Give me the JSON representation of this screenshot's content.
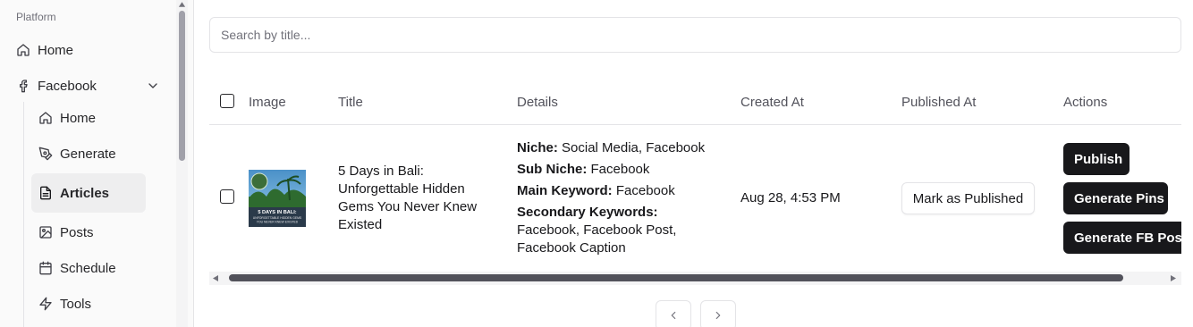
{
  "sidebar": {
    "section_label": "Platform",
    "home": "Home",
    "facebook": "Facebook",
    "sub_items": [
      "Home",
      "Generate",
      "Articles",
      "Posts",
      "Schedule",
      "Tools"
    ],
    "active": "Articles"
  },
  "search": {
    "placeholder": "Search by title...",
    "value": ""
  },
  "table": {
    "columns": [
      "Image",
      "Title",
      "Details",
      "Created At",
      "Published At",
      "Actions"
    ],
    "rows": [
      {
        "image_caption": "5 DAYS IN BALI: UNFORGETTABLE HIDDEN GEMS YOU NEVER KNEW EXISTED",
        "title": "5 Days in Bali: Unforgettable Hidden Gems You Never Knew Existed",
        "details": {
          "niche_label": "Niche:",
          "niche": "Social Media, Facebook",
          "sub_niche_label": "Sub Niche:",
          "sub_niche": "Facebook",
          "main_keyword_label": "Main Keyword:",
          "main_keyword": "Facebook",
          "secondary_keywords_label": "Secondary Keywords:",
          "secondary_keywords": "Facebook, Facebook Post, Facebook Caption"
        },
        "created_at": "Aug 28, 4:53 PM",
        "published_action": "Mark as Published",
        "actions": [
          "Publish",
          "Generate Pins",
          "Generate FB Post"
        ]
      }
    ]
  },
  "colors": {
    "primary": "#18181b",
    "border": "#e4e4e7",
    "muted": "#71717a"
  }
}
